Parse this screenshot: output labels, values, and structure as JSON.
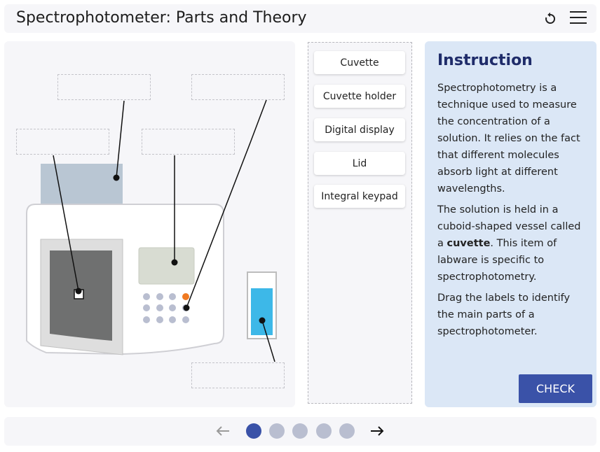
{
  "header": {
    "title": "Spectrophotometer: Parts and Theory",
    "reload_icon": "reload-icon",
    "menu_icon": "hamburger-menu-icon"
  },
  "labels": {
    "items": [
      {
        "label": "Cuvette"
      },
      {
        "label": "Cuvette holder"
      },
      {
        "label": "Digital display"
      },
      {
        "label": "Lid"
      },
      {
        "label": "Integral keypad"
      }
    ]
  },
  "instruction": {
    "title": "Instruction",
    "p1": "Spectrophotometry is a technique used to measure the concentration of a solution. It relies on the fact that different molecules absorb light at different wavelengths.",
    "p2_before": "The solution is held in a cuboid-shaped vessel called a ",
    "p2_bold": "cuvette",
    "p2_after": ". This item of labware is specific to spectrophotometry.",
    "p3": "Drag the labels to identify the main parts of a spectrophotometer.",
    "check_label": "CHECK"
  },
  "pagination": {
    "prev_icon": "arrow-left-icon",
    "next_icon": "arrow-right-icon",
    "current_page": 1,
    "total_pages": 5
  },
  "colors": {
    "accent": "#3a52a8",
    "panel": "#f6f6f9",
    "instruction_bg": "#dbe7f6",
    "cuvette_liquid": "#3db8e8",
    "keypad_orange": "#f07a22"
  }
}
